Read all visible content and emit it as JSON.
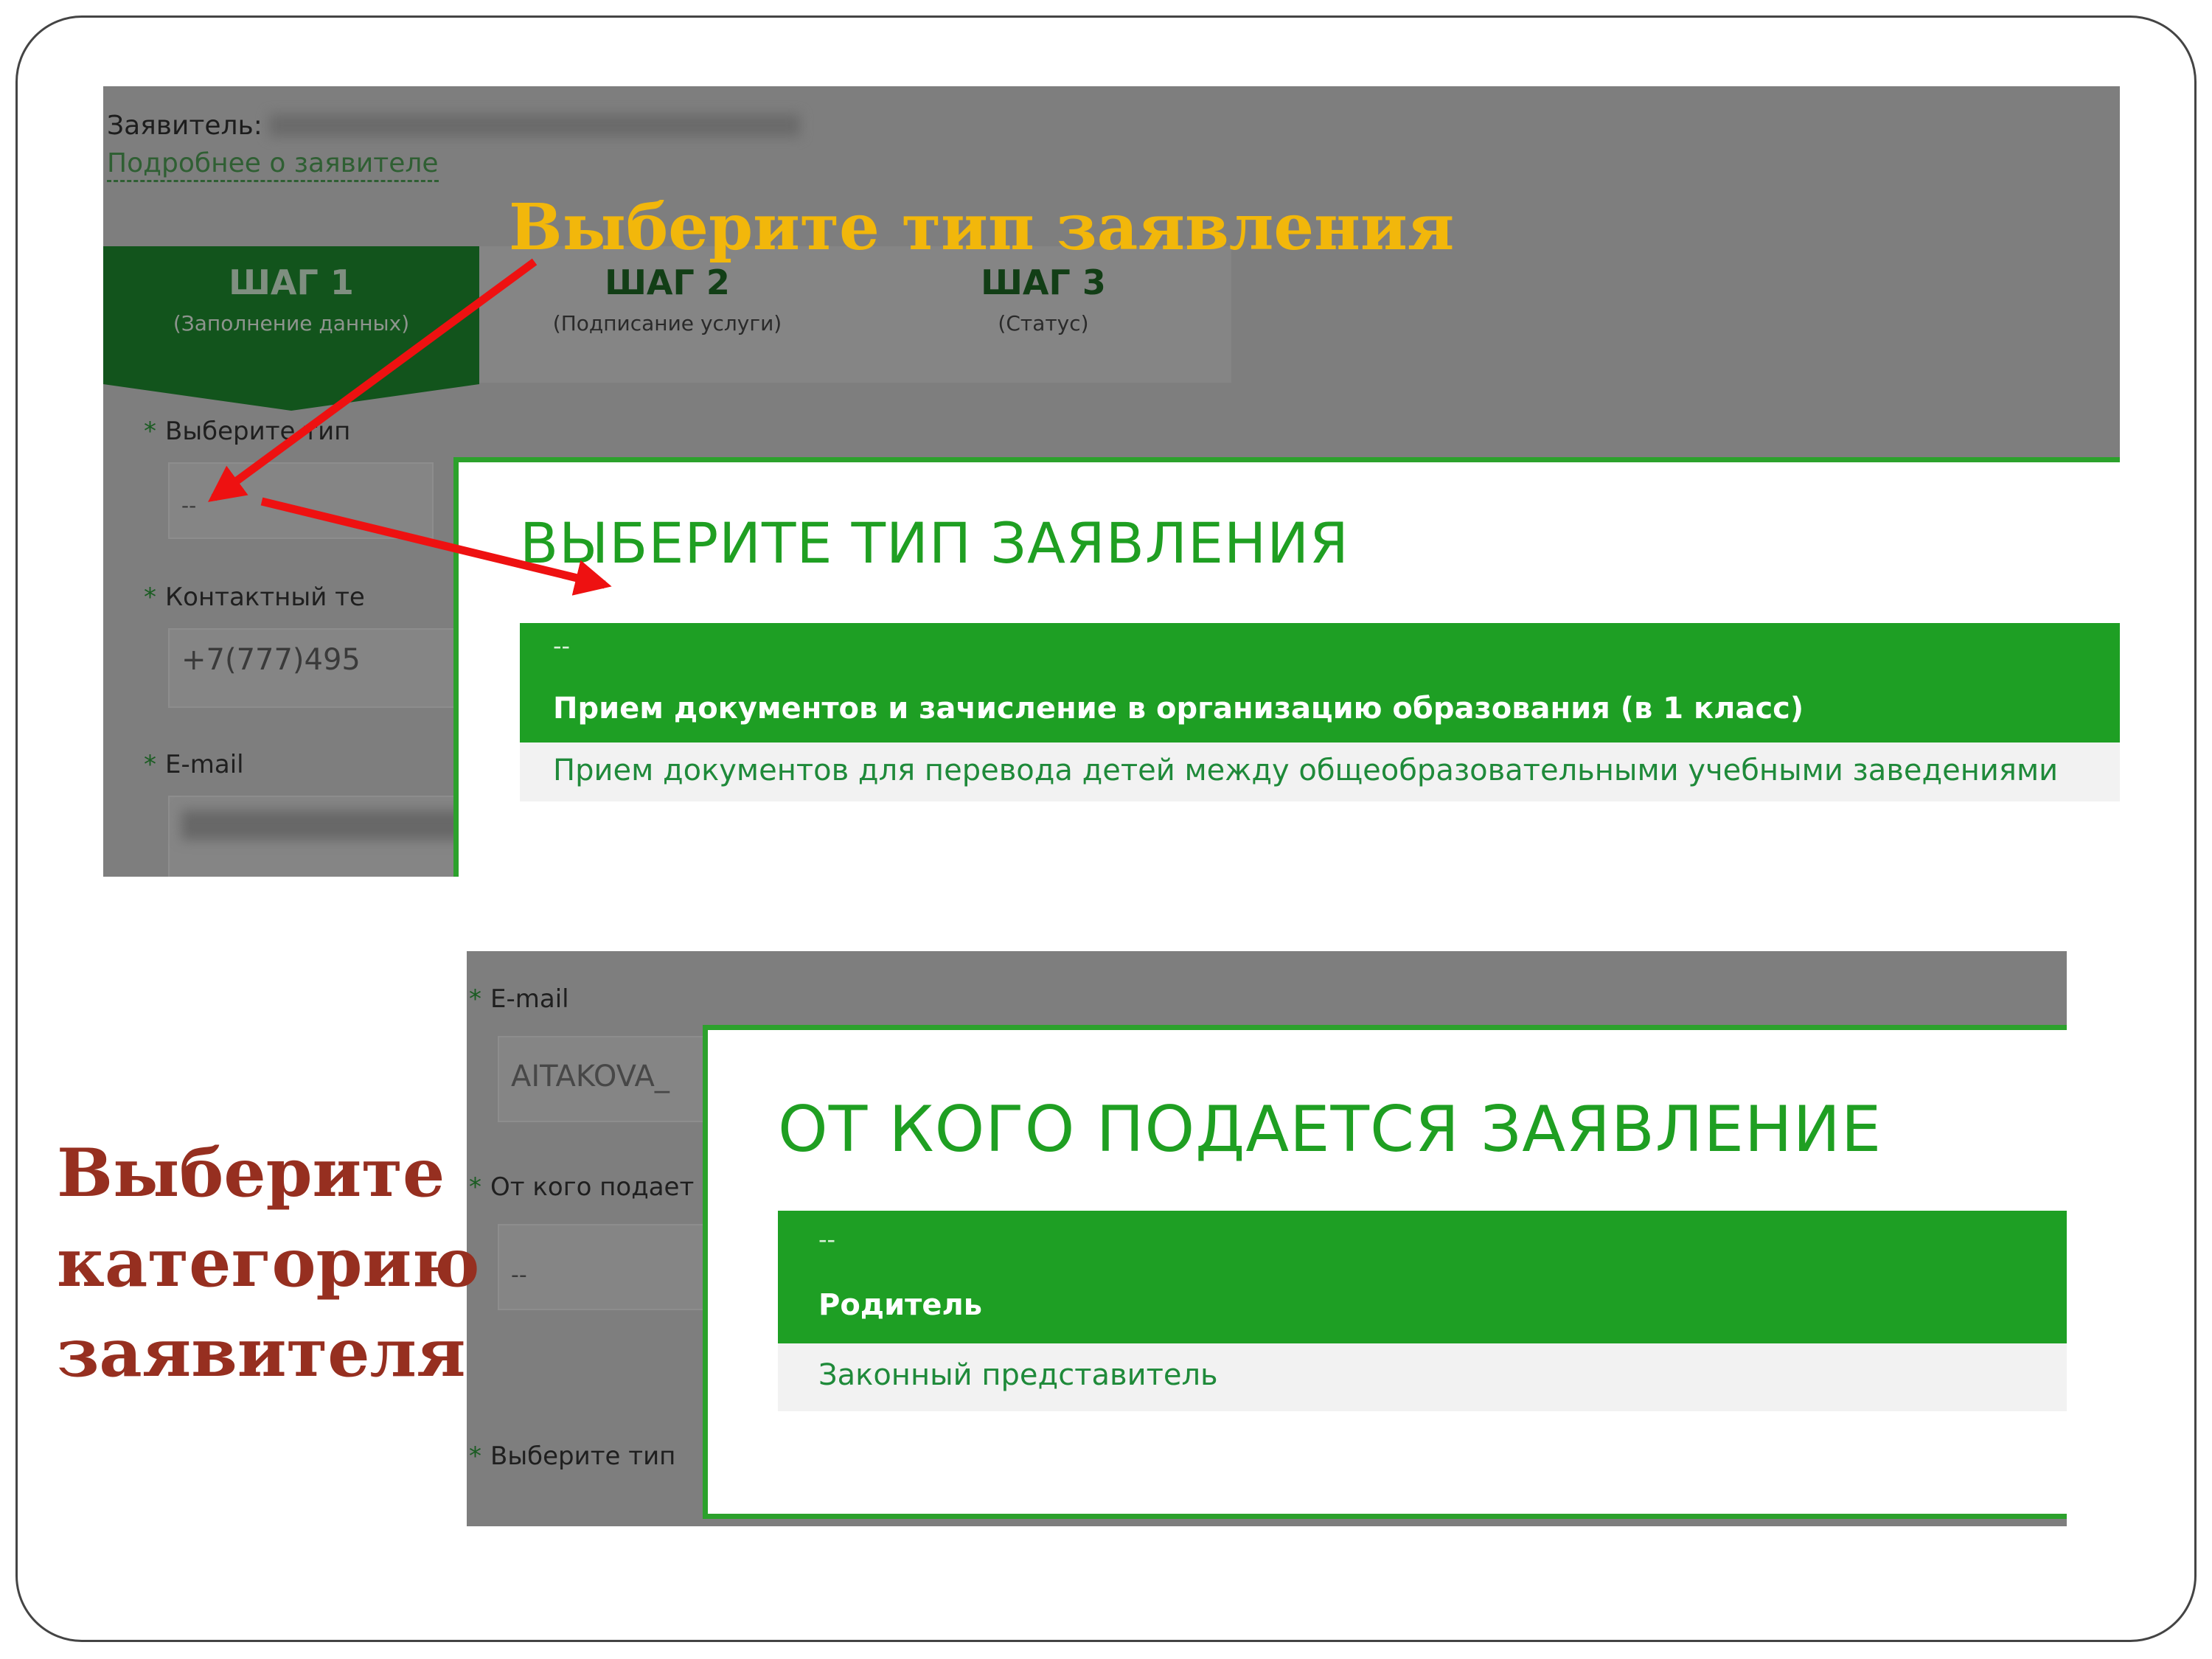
{
  "annotations": {
    "top": "Выберите тип заявления",
    "left": [
      "Выберите",
      "категорию",
      "заявителя"
    ]
  },
  "screenshot1": {
    "applicant_label": "Заявитель:",
    "applicant_link": "Подробнее о заявителе",
    "steps": [
      {
        "title": "ШАГ 1",
        "subtitle": "(Заполнение данных)"
      },
      {
        "title": "ШАГ 2",
        "subtitle": "(Подписание услуги)"
      },
      {
        "title": "ШАГ 3",
        "subtitle": "(Статус)"
      }
    ],
    "fields": {
      "type_label": "Выберите тип",
      "type_value": "--",
      "phone_label": "Контактный те",
      "phone_value": "+7(777)495",
      "email_label": "E-mail"
    },
    "dialog": {
      "title": "ВЫБЕРИТЕ ТИП ЗАЯВЛЕНИЯ",
      "options": [
        "--",
        "Прием документов и зачисление в организацию образования (в 1 класс)",
        "Прием документов для перевода детей между общеобразовательными учебными заведениями"
      ]
    }
  },
  "screenshot2": {
    "fields": {
      "email_label": "E-mail",
      "email_value": "AITAKOVA_",
      "from_label": "От кого подает",
      "from_value": "--",
      "type_label": "Выберите тип"
    },
    "dialog": {
      "title": "ОТ КОГО ПОДАЕТСЯ ЗАЯВЛЕНИЕ",
      "options": [
        "--",
        "Родитель",
        "Законный представитель"
      ]
    }
  },
  "colors": {
    "accent_green": "#1e9f24",
    "dark_green": "#12541c",
    "annotation_yellow": "#f2b70b",
    "annotation_red": "#962f20",
    "arrow_red": "#ee1111"
  }
}
